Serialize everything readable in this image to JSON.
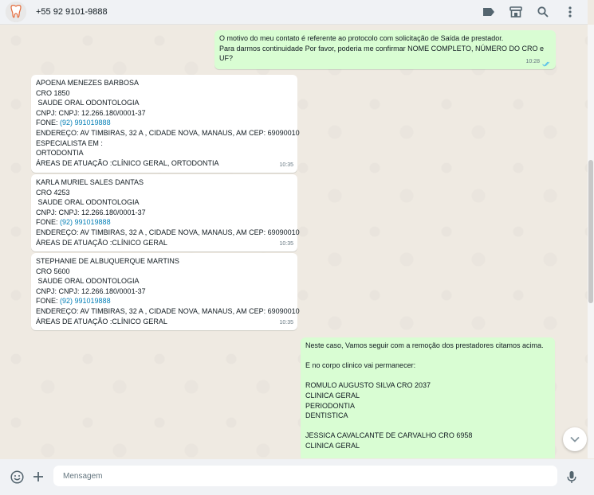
{
  "header": {
    "contact_name": "+55 92 9101-9888",
    "icons": [
      "label-icon",
      "catalog-icon",
      "search-icon",
      "menu-icon"
    ]
  },
  "messages": [
    {
      "direction": "out",
      "lines": [
        "O motivo do meu contato é referente ao protocolo com solicitação de Saída de prestador.",
        "Para darmos continuidade Por favor, poderia me confirmar NOME COMPLETO, NÚMERO DO CRO e",
        "UF?"
      ],
      "time": "10:28",
      "status": "read"
    },
    {
      "direction": "in",
      "lines": [
        "APOENA MENEZES BARBOSA",
        "CRO 1850",
        " SAUDE ORAL ODONTOLOGIA",
        "CNPJ: CNPJ: 12.266.180/0001-37",
        "FONE: ",
        "ENDEREÇO: AV TIMBIRAS, 32 A , CIDADE NOVA, MANAUS, AM CEP: 69090010",
        "ESPECIALISTA EM :",
        "ORTODONTIA",
        "ÁREAS DE ATUAÇÃO :CLÍNICO GERAL, ORTODONTIA"
      ],
      "phone_link": "(92) 991019888",
      "time": "10:35"
    },
    {
      "direction": "in",
      "lines": [
        "KARLA MURIEL SALES DANTAS",
        "CRO 4253",
        " SAUDE ORAL ODONTOLOGIA",
        "CNPJ: CNPJ: 12.266.180/0001-37",
        "FONE: ",
        "ENDEREÇO: AV TIMBIRAS, 32 A , CIDADE NOVA, MANAUS, AM CEP: 69090010",
        "ÁREAS DE ATUAÇÃO :CLÍNICO GERAL"
      ],
      "phone_link": "(92) 991019888",
      "time": "10:35"
    },
    {
      "direction": "in",
      "lines": [
        "STEPHANIE DE ALBUQUERQUE MARTINS",
        "CRO 5600",
        " SAUDE ORAL ODONTOLOGIA",
        "CNPJ: CNPJ: 12.266.180/0001-37",
        "FONE: ",
        "ENDEREÇO: AV TIMBIRAS, 32 A , CIDADE NOVA, MANAUS, AM CEP: 69090010",
        "ÁREAS DE ATUAÇÃO :CLÍNICO GERAL"
      ],
      "phone_link": "(92) 991019888",
      "time": "10:35"
    },
    {
      "direction": "out",
      "lines": [
        "Neste caso, Vamos seguir com a remoção dos prestadores citamos acima.",
        "",
        "E no corpo clinico vai permanecer:",
        "",
        "ROMULO AUGUSTO SILVA CRO 2037",
        "CLINICA GERAL",
        "PERIODONTIA",
        "DENTISTICA",
        "",
        "JESSICA CAVALCANTE DE CARVALHO CRO 6958",
        "CLINICA GERAL"
      ]
    }
  ],
  "composer": {
    "placeholder": "Mensagem",
    "value": ""
  },
  "colors": {
    "incoming_bubble": "#ffffff",
    "outgoing_bubble": "#d9fdd3",
    "chat_background": "#efeae2",
    "link": "#027eb5",
    "read_ticks": "#53bdeb"
  }
}
